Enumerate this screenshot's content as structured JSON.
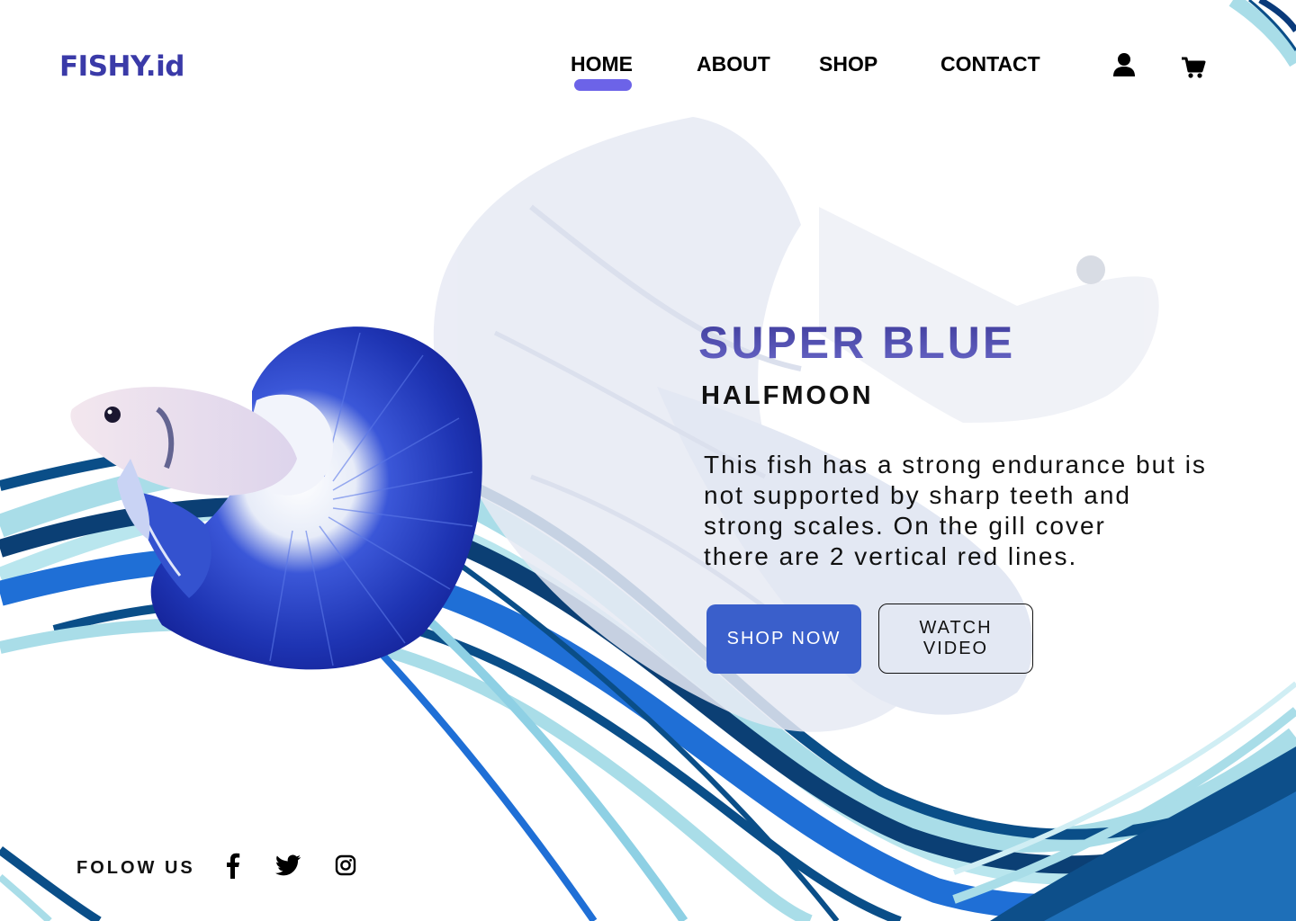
{
  "brand": {
    "logo_text": "FISHY.id"
  },
  "nav": {
    "items": [
      {
        "label": "HOME",
        "active": true
      },
      {
        "label": "ABOUT",
        "active": false
      },
      {
        "label": "SHOP",
        "active": false
      },
      {
        "label": "CONTACT",
        "active": false
      }
    ],
    "icons": [
      "user-icon",
      "cart-icon"
    ],
    "active_color": "#6c63e8"
  },
  "hero": {
    "title": "SUPER BLUE",
    "subtitle": "HALFMOON",
    "description_lines": [
      "This fish has a strong endurance but is",
      "not supported by sharp teeth and",
      "strong scales. On the gill cover",
      "there are 2 vertical red lines."
    ],
    "primary_button": "SHOP NOW",
    "secondary_button": "WATCH VIDEO",
    "primary_color": "#3a5fcb"
  },
  "footer": {
    "follow_label": "FOLOW US",
    "social_icons": [
      "facebook-icon",
      "twitter-icon",
      "instagram-icon"
    ]
  },
  "colors": {
    "brand": "#3a3aa8",
    "wave_dark": "#0a4e88",
    "wave_mid": "#1f6fd6",
    "wave_light": "#a9dde8"
  }
}
